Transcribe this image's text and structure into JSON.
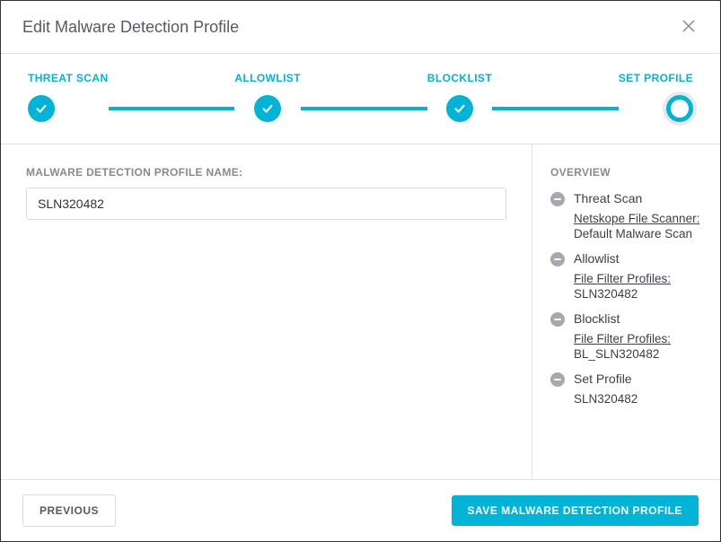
{
  "modal": {
    "title": "Edit Malware Detection Profile"
  },
  "stepper": {
    "steps": [
      "THREAT SCAN",
      "ALLOWLIST",
      "BLOCKLIST",
      "SET PROFILE"
    ]
  },
  "form": {
    "profile_name_label": "MALWARE DETECTION PROFILE NAME:",
    "profile_name_value": "SLN320482"
  },
  "overview": {
    "heading": "OVERVIEW",
    "items": [
      {
        "title": "Threat Scan",
        "link": "Netskope File Scanner:",
        "value": "Default Malware Scan"
      },
      {
        "title": "Allowlist",
        "link": "File Filter Profiles:",
        "value": "SLN320482"
      },
      {
        "title": "Blocklist",
        "link": "File Filter Profiles:",
        "value": "BL_SLN320482"
      },
      {
        "title": "Set Profile",
        "link": null,
        "value": "SLN320482"
      }
    ]
  },
  "footer": {
    "previous_label": "PREVIOUS",
    "save_label": "SAVE MALWARE DETECTION PROFILE"
  }
}
